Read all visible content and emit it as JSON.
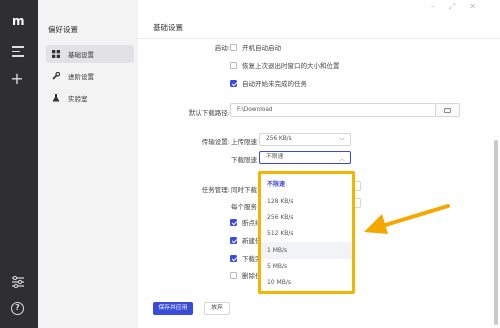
{
  "rail": {
    "logo_icon": "app-logo-icon",
    "menu_icon": "hamburger-menu-icon",
    "add_icon": "plus-icon",
    "settings_icon": "sliders-icon",
    "help_icon": "question-icon",
    "add_glyph": "+",
    "help_glyph": "?"
  },
  "sidebar": {
    "title": "偏好设置",
    "items": [
      {
        "label": "基础设置",
        "icon": "grid-icon",
        "active": true
      },
      {
        "label": "进阶设置",
        "icon": "wrench-icon",
        "active": false
      },
      {
        "label": "实验室",
        "icon": "flask-icon",
        "active": false
      }
    ]
  },
  "main": {
    "header": "基础设置",
    "startup": {
      "label": "启动:",
      "options": [
        {
          "label": "开机自动启动",
          "checked": false
        },
        {
          "label": "恢复上次退出时窗口的大小和位置",
          "checked": false
        },
        {
          "label": "自动开始未完成的任务",
          "checked": true
        }
      ]
    },
    "download_path": {
      "label": "默认下载路径:",
      "value": "F:\\Download"
    },
    "transfer": {
      "label": "传输设置:",
      "upload_label": "上传限速",
      "upload_value": "256 KB/s",
      "download_label": "下载限速",
      "download_value": "不限速"
    },
    "task": {
      "label": "任务管理:",
      "row1_partial": "同时下载",
      "row2_partial": "每个服务",
      "checks": [
        {
          "label": "断点续",
          "checked": true
        },
        {
          "label": "新建任",
          "checked": true
        },
        {
          "label": "下载完",
          "checked": true
        },
        {
          "label": "删除任",
          "checked": false
        }
      ]
    },
    "save_button": "保存并应用",
    "cancel_button": "放弃"
  },
  "dropdown": {
    "options": [
      "不限速",
      "128 KB/s",
      "256 KB/s",
      "512 KB/s",
      "1 MB/s",
      "5 MB/s",
      "10 MB/s"
    ],
    "selected": "不限速",
    "hovered": "1 MB/s"
  },
  "colors": {
    "accent": "#3a4bd8",
    "highlight_border": "#f4b400",
    "rail_bg": "#2f2f33",
    "sidebar_bg": "#f3f3f4"
  }
}
